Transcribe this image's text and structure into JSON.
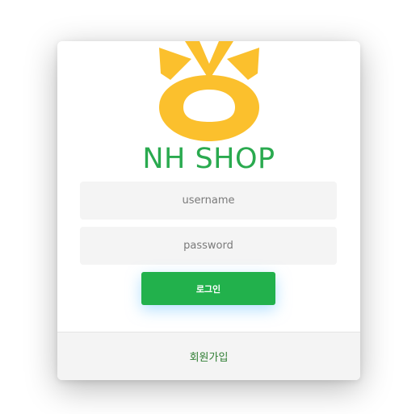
{
  "brand": {
    "title": "NH SHOP",
    "logo_icon": "nh-bank-logo-icon",
    "logo_color": "#fbc02d",
    "title_color": "#2aaa4f"
  },
  "login_form": {
    "username_placeholder": "username",
    "password_placeholder": "password",
    "login_label": "로그인",
    "button_color": "#22b14c"
  },
  "footer": {
    "signup_label": "회원가입"
  }
}
